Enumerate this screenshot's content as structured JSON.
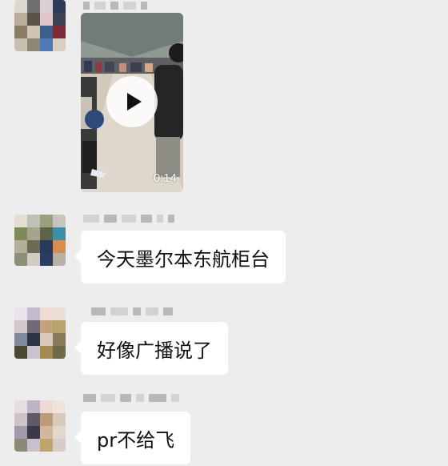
{
  "chat": {
    "messages": [
      {
        "type": "video",
        "duration": "0:14",
        "icon": "play-icon"
      },
      {
        "type": "text",
        "text": "今天墨尔本东航柜台"
      },
      {
        "type": "text",
        "text": "好像广播说了"
      },
      {
        "type": "text",
        "text": "pr不给飞"
      }
    ]
  },
  "colors": {
    "background": "#ededed",
    "bubble": "#ffffff",
    "text": "#111111"
  }
}
